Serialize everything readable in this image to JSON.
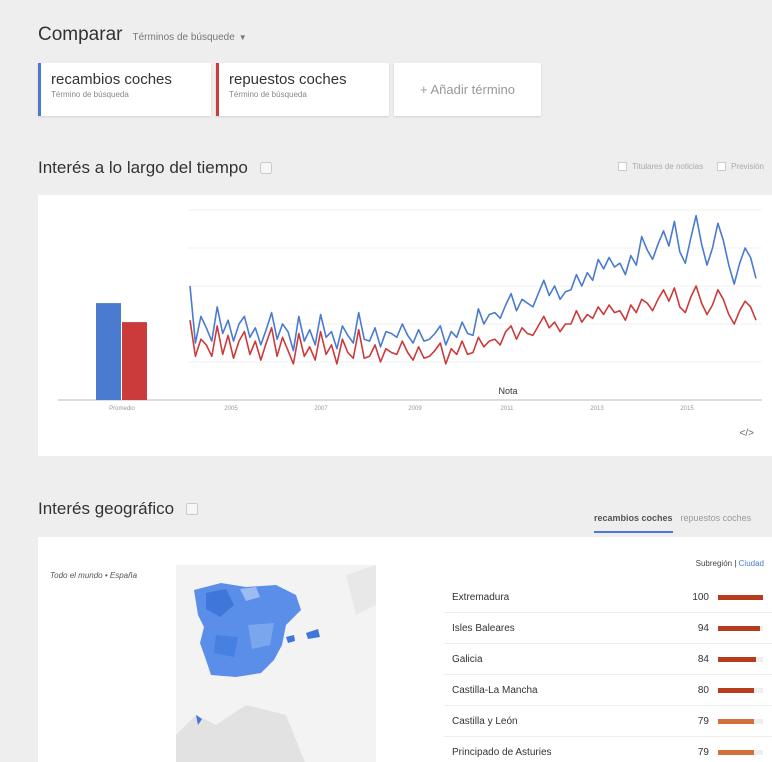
{
  "compare": {
    "title": "Comparar",
    "dropdown": "Términos de búsquede"
  },
  "terms": [
    {
      "name": "recambios coches",
      "sub": "Término de búsqueda",
      "color": "#4a7bd0"
    },
    {
      "name": "repuestos coches",
      "sub": "Término de búsqueda",
      "color": "#cc3b3b"
    }
  ],
  "add_term": "+ Añadir término",
  "interest_time": {
    "title": "Interés a lo largo del tiempo",
    "opt_news": "Titulares de noticias",
    "opt_preview": "Previsión"
  },
  "chart_data": {
    "type": "line",
    "average_label": "Promedio",
    "averages": [
      51,
      41
    ],
    "x_ticks": [
      "2005",
      "2007",
      "2009",
      "2011",
      "2013",
      "2015"
    ],
    "note_label": "Nota",
    "series": [
      {
        "name": "recambios coches",
        "color": "#4a7bd0",
        "values": [
          60,
          30,
          44,
          38,
          31,
          49,
          35,
          42,
          31,
          40,
          44,
          33,
          38,
          29,
          37,
          46,
          32,
          40,
          36,
          26,
          44,
          31,
          37,
          29,
          45,
          33,
          36,
          27,
          39,
          34,
          30,
          46,
          32,
          31,
          38,
          28,
          36,
          35,
          33,
          40,
          34,
          30,
          37,
          31,
          32,
          35,
          39,
          29,
          36,
          33,
          41,
          35,
          34,
          48,
          40,
          45,
          46,
          43,
          50,
          56,
          47,
          53,
          51,
          49,
          56,
          63,
          55,
          60,
          53,
          57,
          58,
          66,
          60,
          67,
          63,
          74,
          69,
          75,
          70,
          72,
          66,
          76,
          71,
          86,
          79,
          74,
          82,
          89,
          81,
          94,
          78,
          72,
          85,
          97,
          82,
          71,
          80,
          93,
          84,
          71,
          61,
          72,
          80,
          75,
          64
        ]
      },
      {
        "name": "repuestos coches",
        "color": "#cc3b3b",
        "values": [
          42,
          23,
          32,
          29,
          23,
          39,
          24,
          34,
          22,
          31,
          36,
          24,
          31,
          21,
          30,
          38,
          23,
          33,
          26,
          19,
          35,
          23,
          28,
          21,
          36,
          24,
          29,
          19,
          32,
          25,
          22,
          37,
          22,
          23,
          29,
          20,
          27,
          25,
          24,
          31,
          25,
          21,
          28,
          22,
          23,
          26,
          30,
          19,
          27,
          24,
          31,
          24,
          25,
          33,
          28,
          31,
          32,
          29,
          36,
          39,
          32,
          38,
          35,
          34,
          39,
          44,
          38,
          41,
          36,
          40,
          40,
          47,
          41,
          45,
          43,
          49,
          45,
          50,
          46,
          47,
          42,
          50,
          46,
          53,
          51,
          47,
          53,
          58,
          52,
          59,
          49,
          46,
          54,
          60,
          51,
          45,
          50,
          58,
          53,
          45,
          40,
          47,
          52,
          49,
          42
        ]
      }
    ]
  },
  "geo": {
    "title": "Interés geográfico",
    "tab_active": "recambios coches",
    "tab_other": "repuestos coches",
    "crumb": "Todo el mundo • España",
    "header_region": "Subregión",
    "header_city": "Ciudad",
    "regions": [
      {
        "name": "Extremadura",
        "value": 100
      },
      {
        "name": "Isles Baleares",
        "value": 94
      },
      {
        "name": "Galicia",
        "value": 84
      },
      {
        "name": "Castilla-La Mancha",
        "value": 80
      },
      {
        "name": "Castilla y León",
        "value": 79
      },
      {
        "name": "Principado de Asturies",
        "value": 79
      }
    ]
  }
}
